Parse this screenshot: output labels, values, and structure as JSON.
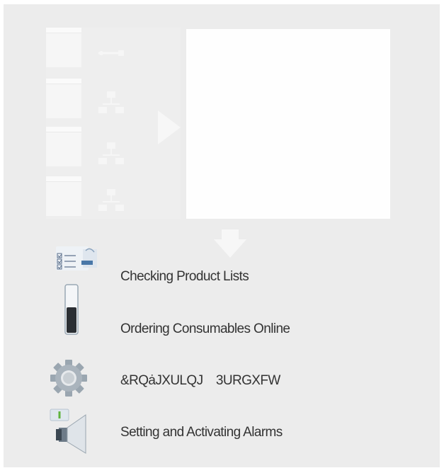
{
  "features": [
    {
      "label": "Checking Product Lists",
      "icon": "checklist-icon"
    },
    {
      "label": "Ordering Consumables Online",
      "icon": "ink-cartridge-icon"
    },
    {
      "label": "&RQȧJXULQJ 3URGXFW",
      "icon": "gear-icon"
    },
    {
      "label": "Setting and Activating Alarms",
      "icon": "alarm-speaker-icon"
    }
  ],
  "colors": {
    "background": "#ececec",
    "monitor": "#fefefe",
    "text": "#333333"
  }
}
